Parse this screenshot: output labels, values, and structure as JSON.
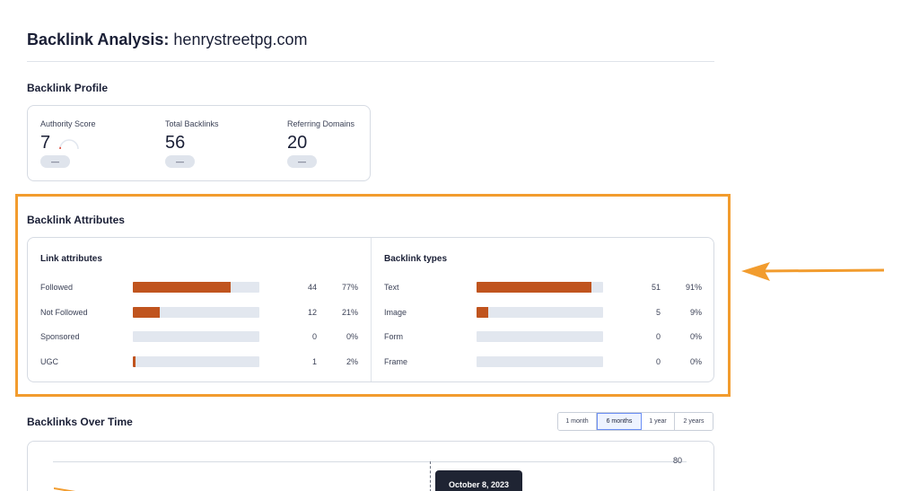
{
  "header": {
    "title_prefix": "Backlink Analysis:",
    "domain": "henrystreetpg.com"
  },
  "profile": {
    "heading": "Backlink Profile",
    "metrics": [
      {
        "label": "Authority Score",
        "value": "7",
        "change": "—"
      },
      {
        "label": "Total Backlinks",
        "value": "56",
        "change": "—"
      },
      {
        "label": "Referring Domains",
        "value": "20",
        "change": "—"
      }
    ],
    "authority_gauge_fraction": 0.07
  },
  "attributes": {
    "heading": "Backlink Attributes",
    "link_attributes": {
      "title": "Link attributes",
      "rows": [
        {
          "label": "Followed",
          "count": "44",
          "percent": "77%",
          "fraction": 0.77
        },
        {
          "label": "Not Followed",
          "count": "12",
          "percent": "21%",
          "fraction": 0.21
        },
        {
          "label": "Sponsored",
          "count": "0",
          "percent": "0%",
          "fraction": 0
        },
        {
          "label": "UGC",
          "count": "1",
          "percent": "2%",
          "fraction": 0.02
        }
      ]
    },
    "backlink_types": {
      "title": "Backlink types",
      "rows": [
        {
          "label": "Text",
          "count": "51",
          "percent": "91%",
          "fraction": 0.91
        },
        {
          "label": "Image",
          "count": "5",
          "percent": "9%",
          "fraction": 0.09
        },
        {
          "label": "Form",
          "count": "0",
          "percent": "0%",
          "fraction": 0
        },
        {
          "label": "Frame",
          "count": "0",
          "percent": "0%",
          "fraction": 0
        }
      ]
    }
  },
  "over_time": {
    "heading": "Backlinks Over Time",
    "ranges": [
      {
        "label": "1 month",
        "active": false
      },
      {
        "label": "6 months",
        "active": true
      },
      {
        "label": "1 year",
        "active": false
      },
      {
        "label": "2 years",
        "active": false
      }
    ],
    "y_tick": "80",
    "tooltip_date": "October 8, 2023"
  },
  "colors": {
    "bar_fill": "#c0541e",
    "bar_track": "#e2e7ef",
    "highlight": "#f29c2e",
    "active_range": "#6c8ff5"
  }
}
